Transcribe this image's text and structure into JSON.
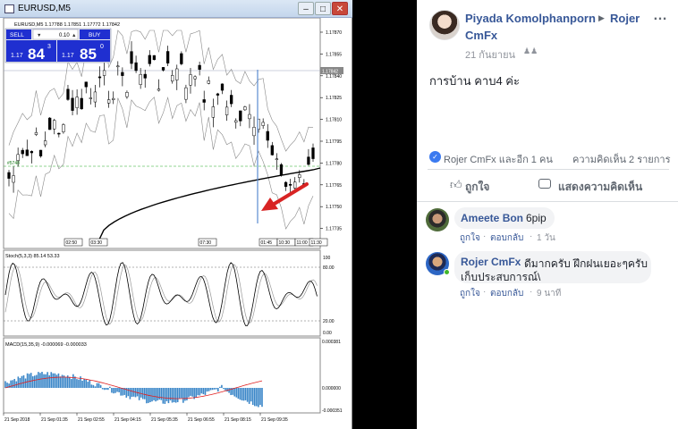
{
  "mt4": {
    "window_title": "EURUSD,M5",
    "symbol_info": "EURUSD,M5  1.17788 1.17851 1.17772 1.17842",
    "sell_label": "SELL",
    "buy_label": "BUY",
    "lot": "0.10",
    "sell_price_prefix": "1.17",
    "sell_price_big": "84",
    "sell_price_sup": "3",
    "buy_price_prefix": "1.17",
    "buy_price_big": "85",
    "buy_price_sup": "0",
    "price_ticks": [
      "1.17870",
      "1.17855",
      "1.17840",
      "1.17825",
      "1.17810",
      "1.17795",
      "1.17780",
      "1.17765",
      "1.17750",
      "1.17735"
    ],
    "current_price": "1.17842",
    "level_label": "#5748",
    "time_ticks_main": [
      "02:50",
      "03:30",
      "07:30",
      "01:45",
      "10:30",
      "11:00",
      "11:30"
    ],
    "stoch_label": "Stoch(5,3,3) 85.14 53.33",
    "stoch_ticks": [
      "100",
      "80.00",
      "20.00",
      "0.00"
    ],
    "macd_label": "MACD(15,35,9) -0.000069 -0.000033",
    "macd_ticks": [
      "0.000381",
      "0.000000",
      "-0.000351"
    ],
    "time_axis": [
      "21 Sep 2018",
      "21 Sep 01:35",
      "21 Sep 02:55",
      "21 Sep 04:15",
      "21 Sep 05:35",
      "21 Sep 06:55",
      "21 Sep 08:15",
      "21 Sep 09:35"
    ]
  },
  "post": {
    "author": "Piyada Komolphanporn",
    "page": "Rojer",
    "page_line2": "CmFx",
    "date": "21 กันยายน",
    "body": "การบ้าน คาบ4 ค่ะ",
    "reactions": "Rojer CmFx และอีก 1 คน",
    "comments_count": "ความคิดเห็น 2 รายการ",
    "like_label": "ถูกใจ",
    "comment_label": "แสดงความคิดเห็น"
  },
  "comments": [
    {
      "name": "Ameete Bon",
      "text": "6pip",
      "text2": "",
      "like": "ถูกใจ",
      "reply": "ตอบกลับ",
      "time": "1 วัน"
    },
    {
      "name": "Rojer CmFx",
      "text": "ดีมากครับ ฝึกฝนเยอะๆครับ",
      "text2": "เก็บประสบการณ์\\",
      "like": "ถูกใจ",
      "reply": "ตอบกลับ",
      "time": "9 นาที"
    }
  ],
  "colors": {
    "fb_blue": "#385898",
    "fb_gray": "#90949c",
    "mt4_buy_blue": "#1f2fd0",
    "arrow_red": "#d82424",
    "ma_black": "#000000",
    "macd_blue": "#3a86c8",
    "signal_red": "#e02020"
  }
}
